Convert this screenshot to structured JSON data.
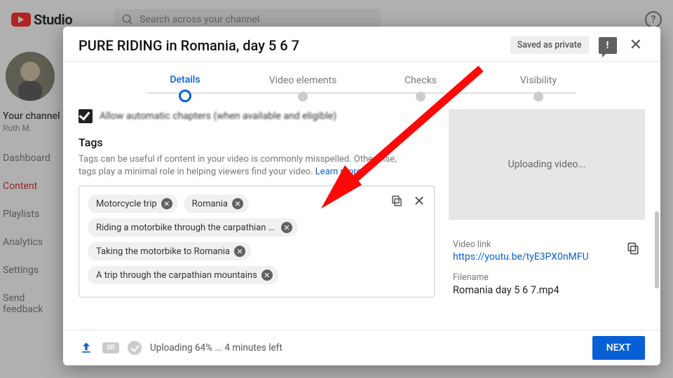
{
  "app": {
    "name": "Studio",
    "search_placeholder": "Search across your channel"
  },
  "sidebar": {
    "your_channel_label": "Your channel",
    "channel_name": "Ruth M.",
    "items": [
      {
        "label": "Dashboard",
        "active": false
      },
      {
        "label": "Content",
        "active": true
      },
      {
        "label": "Playlists",
        "active": false
      },
      {
        "label": "Analytics",
        "active": false
      },
      {
        "label": "Settings",
        "active": false
      },
      {
        "label": "Send feedback",
        "active": false
      }
    ]
  },
  "modal": {
    "title": "PURE RIDING in Romania, day 5 6 7",
    "saved_state": "Saved as private",
    "steps": [
      "Details",
      "Video elements",
      "Checks",
      "Visibility"
    ],
    "active_step": 0,
    "chapters_label": "Allow automatic chapters (when available and eligible)",
    "tags": {
      "title": "Tags",
      "description": "Tags can be useful if content in your video is commonly misspelled. Otherwise, tags play a minimal role in helping viewers find your video.",
      "learn_more": "Learn more",
      "chips": [
        "Motorcycle trip",
        "Romania",
        "Riding a motorbike through the carpathian moun…",
        "Taking the motorbike to Romania",
        "A trip through the carpathian mountains"
      ]
    },
    "preview": {
      "status": "Uploading video...",
      "video_link_label": "Video link",
      "video_link": "https://youtu.be/tyE3PX0nMFU",
      "filename_label": "Filename",
      "filename": "Romania day 5 6 7.mp4"
    },
    "footer": {
      "progress_text": "Uploading 64% ... 4 minutes left",
      "next_label": "NEXT"
    }
  }
}
